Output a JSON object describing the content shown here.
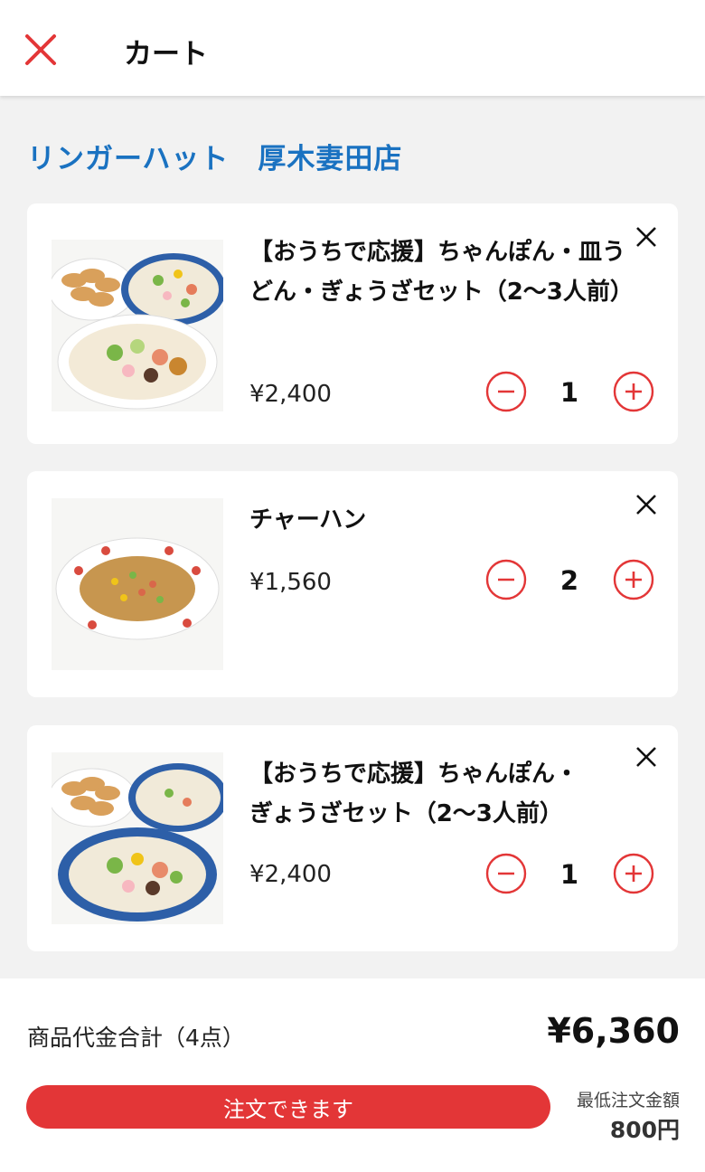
{
  "header": {
    "title": "カート",
    "close_icon": "close-icon"
  },
  "store": {
    "name": "リンガーハット　厚木妻田店"
  },
  "cart_items": [
    {
      "name": "【おうちで応援】ちゃんぽん・皿うどん・ぎょうざセット（2〜3人前）",
      "price": "¥2,400",
      "quantity": "1",
      "image": "champon-saraudon-gyoza-set-photo"
    },
    {
      "name": "チャーハン",
      "price": "¥1,560",
      "quantity": "2",
      "image": "fried-rice-photo"
    },
    {
      "name": "【おうちで応援】ちゃんぽん・ぎょうざセット（2〜3人前）",
      "price": "¥2,400",
      "quantity": "1",
      "image": "champon-gyoza-set-photo"
    }
  ],
  "footer": {
    "total_label": "商品代金合計（4点）",
    "total_amount": "¥6,360",
    "order_button_label": "注文できます",
    "min_order_label": "最低注文金額",
    "min_order_amount": "800円"
  },
  "colors": {
    "accent_red": "#e33637",
    "store_blue": "#1a72c1",
    "background": "#f2f2f2"
  }
}
